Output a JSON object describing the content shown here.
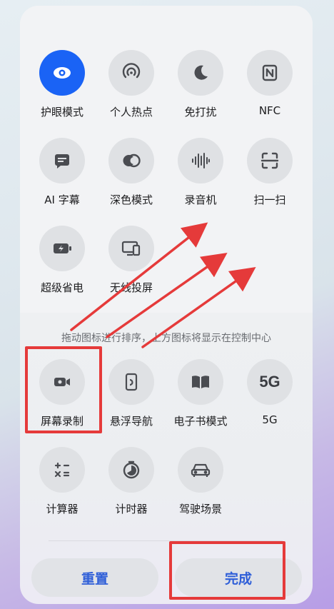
{
  "tiles_active": [
    {
      "label": "护眼模式",
      "icon": "eye-icon"
    },
    {
      "label": "个人热点",
      "icon": "hotspot-icon"
    },
    {
      "label": "免打扰",
      "icon": "moon-icon"
    },
    {
      "label": "NFC",
      "icon": "nfc-icon"
    },
    {
      "label": "AI 字幕",
      "icon": "subtitle-icon"
    },
    {
      "label": "深色模式",
      "icon": "dark-mode-icon"
    },
    {
      "label": "录音机",
      "icon": "recorder-icon"
    },
    {
      "label": "扫一扫",
      "icon": "scan-icon"
    },
    {
      "label": "超级省电",
      "icon": "battery-saver-icon"
    },
    {
      "label": "无线投屏",
      "icon": "cast-icon"
    }
  ],
  "hint": "拖动图标进行排序，上方图标将显示在控制中心",
  "tiles_available": [
    {
      "label": "屏幕录制",
      "icon": "screen-record-icon"
    },
    {
      "label": "悬浮导航",
      "icon": "floating-nav-icon"
    },
    {
      "label": "电子书模式",
      "icon": "ebook-icon"
    },
    {
      "label": "5G",
      "icon": "5g-icon",
      "glyph": "5G"
    },
    {
      "label": "计算器",
      "icon": "calculator-icon"
    },
    {
      "label": "计时器",
      "icon": "timer-icon"
    },
    {
      "label": "驾驶场景",
      "icon": "car-icon"
    }
  ],
  "buttons": {
    "reset": "重置",
    "done": "完成"
  },
  "colors": {
    "accent": "#1a63f5",
    "highlight": "#e53a3a",
    "button_text": "#2f5fd8"
  }
}
